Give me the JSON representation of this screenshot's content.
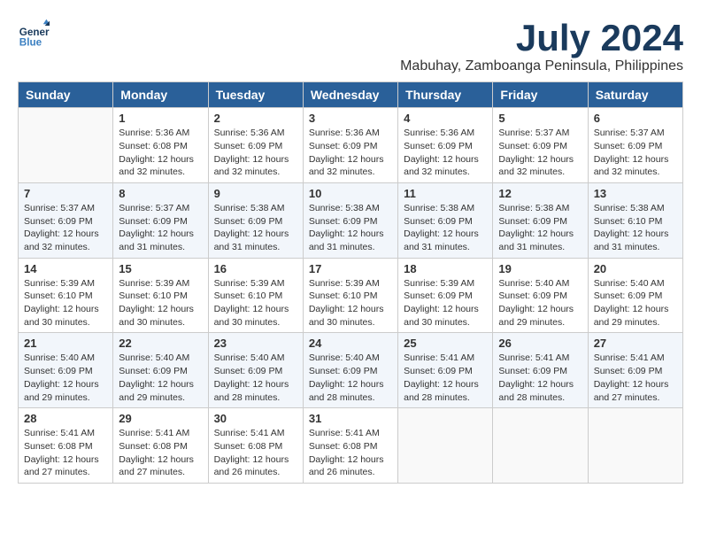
{
  "app": {
    "name": "GeneralBlue",
    "logo_blue": "Blue"
  },
  "header": {
    "month_year": "July 2024",
    "location": "Mabuhay, Zamboanga Peninsula, Philippines"
  },
  "weekdays": [
    "Sunday",
    "Monday",
    "Tuesday",
    "Wednesday",
    "Thursday",
    "Friday",
    "Saturday"
  ],
  "weeks": [
    [
      {
        "day": "",
        "sunrise": "",
        "sunset": "",
        "daylight": ""
      },
      {
        "day": "1",
        "sunrise": "Sunrise: 5:36 AM",
        "sunset": "Sunset: 6:08 PM",
        "daylight": "Daylight: 12 hours and 32 minutes."
      },
      {
        "day": "2",
        "sunrise": "Sunrise: 5:36 AM",
        "sunset": "Sunset: 6:09 PM",
        "daylight": "Daylight: 12 hours and 32 minutes."
      },
      {
        "day": "3",
        "sunrise": "Sunrise: 5:36 AM",
        "sunset": "Sunset: 6:09 PM",
        "daylight": "Daylight: 12 hours and 32 minutes."
      },
      {
        "day": "4",
        "sunrise": "Sunrise: 5:36 AM",
        "sunset": "Sunset: 6:09 PM",
        "daylight": "Daylight: 12 hours and 32 minutes."
      },
      {
        "day": "5",
        "sunrise": "Sunrise: 5:37 AM",
        "sunset": "Sunset: 6:09 PM",
        "daylight": "Daylight: 12 hours and 32 minutes."
      },
      {
        "day": "6",
        "sunrise": "Sunrise: 5:37 AM",
        "sunset": "Sunset: 6:09 PM",
        "daylight": "Daylight: 12 hours and 32 minutes."
      }
    ],
    [
      {
        "day": "7",
        "sunrise": "Sunrise: 5:37 AM",
        "sunset": "Sunset: 6:09 PM",
        "daylight": "Daylight: 12 hours and 32 minutes."
      },
      {
        "day": "8",
        "sunrise": "Sunrise: 5:37 AM",
        "sunset": "Sunset: 6:09 PM",
        "daylight": "Daylight: 12 hours and 31 minutes."
      },
      {
        "day": "9",
        "sunrise": "Sunrise: 5:38 AM",
        "sunset": "Sunset: 6:09 PM",
        "daylight": "Daylight: 12 hours and 31 minutes."
      },
      {
        "day": "10",
        "sunrise": "Sunrise: 5:38 AM",
        "sunset": "Sunset: 6:09 PM",
        "daylight": "Daylight: 12 hours and 31 minutes."
      },
      {
        "day": "11",
        "sunrise": "Sunrise: 5:38 AM",
        "sunset": "Sunset: 6:09 PM",
        "daylight": "Daylight: 12 hours and 31 minutes."
      },
      {
        "day": "12",
        "sunrise": "Sunrise: 5:38 AM",
        "sunset": "Sunset: 6:09 PM",
        "daylight": "Daylight: 12 hours and 31 minutes."
      },
      {
        "day": "13",
        "sunrise": "Sunrise: 5:38 AM",
        "sunset": "Sunset: 6:10 PM",
        "daylight": "Daylight: 12 hours and 31 minutes."
      }
    ],
    [
      {
        "day": "14",
        "sunrise": "Sunrise: 5:39 AM",
        "sunset": "Sunset: 6:10 PM",
        "daylight": "Daylight: 12 hours and 30 minutes."
      },
      {
        "day": "15",
        "sunrise": "Sunrise: 5:39 AM",
        "sunset": "Sunset: 6:10 PM",
        "daylight": "Daylight: 12 hours and 30 minutes."
      },
      {
        "day": "16",
        "sunrise": "Sunrise: 5:39 AM",
        "sunset": "Sunset: 6:10 PM",
        "daylight": "Daylight: 12 hours and 30 minutes."
      },
      {
        "day": "17",
        "sunrise": "Sunrise: 5:39 AM",
        "sunset": "Sunset: 6:10 PM",
        "daylight": "Daylight: 12 hours and 30 minutes."
      },
      {
        "day": "18",
        "sunrise": "Sunrise: 5:39 AM",
        "sunset": "Sunset: 6:09 PM",
        "daylight": "Daylight: 12 hours and 30 minutes."
      },
      {
        "day": "19",
        "sunrise": "Sunrise: 5:40 AM",
        "sunset": "Sunset: 6:09 PM",
        "daylight": "Daylight: 12 hours and 29 minutes."
      },
      {
        "day": "20",
        "sunrise": "Sunrise: 5:40 AM",
        "sunset": "Sunset: 6:09 PM",
        "daylight": "Daylight: 12 hours and 29 minutes."
      }
    ],
    [
      {
        "day": "21",
        "sunrise": "Sunrise: 5:40 AM",
        "sunset": "Sunset: 6:09 PM",
        "daylight": "Daylight: 12 hours and 29 minutes."
      },
      {
        "day": "22",
        "sunrise": "Sunrise: 5:40 AM",
        "sunset": "Sunset: 6:09 PM",
        "daylight": "Daylight: 12 hours and 29 minutes."
      },
      {
        "day": "23",
        "sunrise": "Sunrise: 5:40 AM",
        "sunset": "Sunset: 6:09 PM",
        "daylight": "Daylight: 12 hours and 28 minutes."
      },
      {
        "day": "24",
        "sunrise": "Sunrise: 5:40 AM",
        "sunset": "Sunset: 6:09 PM",
        "daylight": "Daylight: 12 hours and 28 minutes."
      },
      {
        "day": "25",
        "sunrise": "Sunrise: 5:41 AM",
        "sunset": "Sunset: 6:09 PM",
        "daylight": "Daylight: 12 hours and 28 minutes."
      },
      {
        "day": "26",
        "sunrise": "Sunrise: 5:41 AM",
        "sunset": "Sunset: 6:09 PM",
        "daylight": "Daylight: 12 hours and 28 minutes."
      },
      {
        "day": "27",
        "sunrise": "Sunrise: 5:41 AM",
        "sunset": "Sunset: 6:09 PM",
        "daylight": "Daylight: 12 hours and 27 minutes."
      }
    ],
    [
      {
        "day": "28",
        "sunrise": "Sunrise: 5:41 AM",
        "sunset": "Sunset: 6:08 PM",
        "daylight": "Daylight: 12 hours and 27 minutes."
      },
      {
        "day": "29",
        "sunrise": "Sunrise: 5:41 AM",
        "sunset": "Sunset: 6:08 PM",
        "daylight": "Daylight: 12 hours and 27 minutes."
      },
      {
        "day": "30",
        "sunrise": "Sunrise: 5:41 AM",
        "sunset": "Sunset: 6:08 PM",
        "daylight": "Daylight: 12 hours and 26 minutes."
      },
      {
        "day": "31",
        "sunrise": "Sunrise: 5:41 AM",
        "sunset": "Sunset: 6:08 PM",
        "daylight": "Daylight: 12 hours and 26 minutes."
      },
      {
        "day": "",
        "sunrise": "",
        "sunset": "",
        "daylight": ""
      },
      {
        "day": "",
        "sunrise": "",
        "sunset": "",
        "daylight": ""
      },
      {
        "day": "",
        "sunrise": "",
        "sunset": "",
        "daylight": ""
      }
    ]
  ]
}
